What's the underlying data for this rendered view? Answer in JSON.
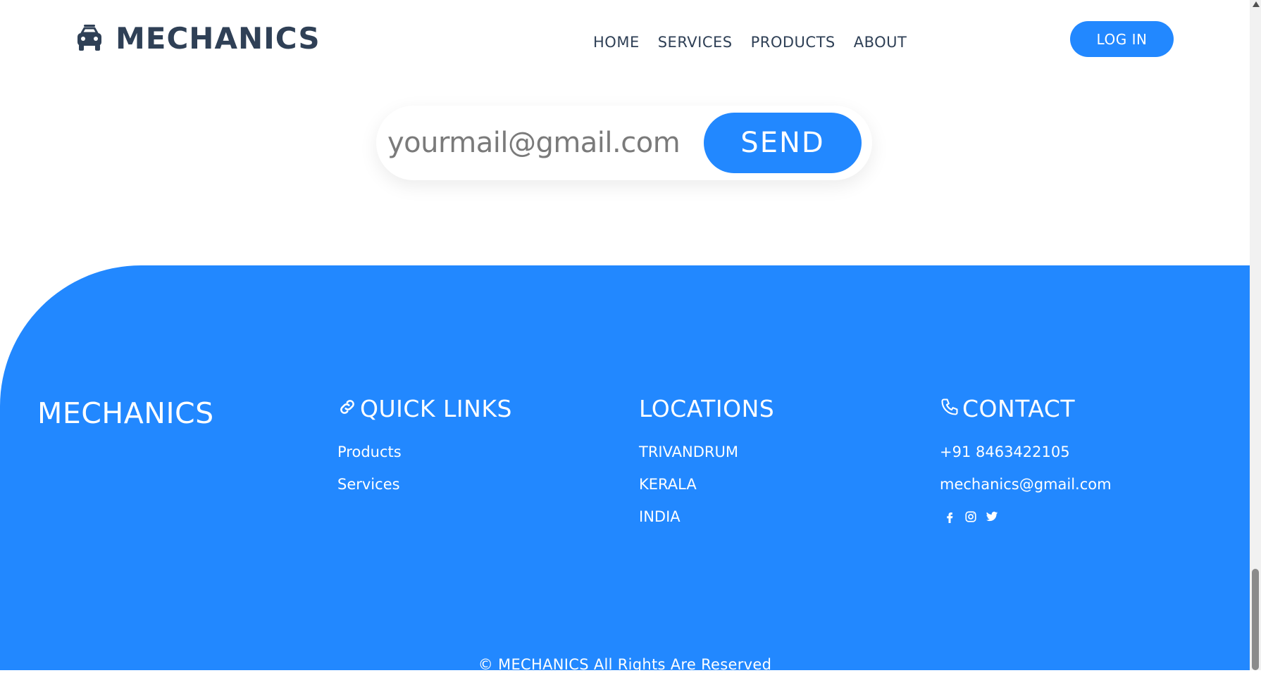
{
  "header": {
    "brand": "MECHANICS",
    "brand_icon": "car-icon",
    "nav": [
      "HOME",
      "SERVICES",
      "PRODUCTS",
      "ABOUT"
    ],
    "login_label": "LOG IN"
  },
  "subscribe": {
    "email_placeholder": "yourmail@gmail.com",
    "send_label": "SEND"
  },
  "footer": {
    "brand": "MECHANICS",
    "quick_links": {
      "icon": "link-icon",
      "title": "QUICK LINKS",
      "items": [
        "Products",
        "Services"
      ]
    },
    "locations": {
      "title": "LOCATIONS",
      "items": [
        "TRIVANDRUM",
        "KERALA",
        "INDIA"
      ]
    },
    "contact": {
      "icon": "phone-icon",
      "title": "CONTACT",
      "phone": "+91 8463422105",
      "email": "mechanics@gmail.com",
      "social_icons": [
        "facebook-icon",
        "instagram-icon",
        "twitter-icon"
      ]
    },
    "copyright": "© MECHANICS All Rights Are Reserved"
  },
  "colors": {
    "accent": "#2288ff",
    "text_dark": "#2f4056",
    "background": "#ffffff"
  }
}
